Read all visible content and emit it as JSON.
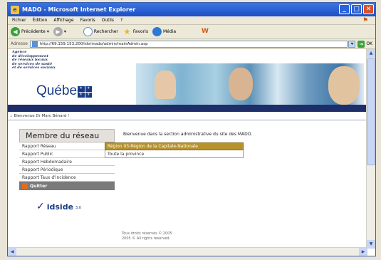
{
  "window": {
    "title": "MADO - Microsoft Internet Explorer",
    "controls": {
      "minimize": "_",
      "maximize": "□",
      "close": "✕"
    }
  },
  "menubar": [
    "Fichier",
    "Édition",
    "Affichage",
    "Favoris",
    "Outils",
    "?"
  ],
  "toolbar": {
    "back_label": "Précédente",
    "search_label": "Rechercher",
    "favorites_label": "Favoris",
    "media_label": "Média"
  },
  "addressbar": {
    "label": "Adresse",
    "url": "http://69.159.153.200/idv/mado/admin/mainAdmin.asp",
    "go_label": "OK"
  },
  "page": {
    "agency_lines": [
      "Agence",
      "de développement",
      "de réseaux locaux",
      "de services de santé",
      "et de services sociaux"
    ],
    "quebec": "Québec",
    "welcome": ":: Bienvenue Dr Marc Bénard !",
    "intro": "Bienvenue dans la section administrative du site des MADO.",
    "sidebar": {
      "title": "Membre du réseau",
      "items": [
        "Rapport Réseau",
        "Rapport Public",
        "Rapport Hebdomadaire",
        "Rapport Périodique",
        "Rapport Taux d'incidence"
      ],
      "quit": "Quitter"
    },
    "dropdown": {
      "selected": "Région 03-Région de la Capitale-Nationale",
      "option": "Toute la province"
    },
    "logo": {
      "name": "idside",
      "version": "3.0"
    },
    "footer": [
      "Tous droits réservés © 2005",
      "2005 © All rights reserved."
    ]
  }
}
